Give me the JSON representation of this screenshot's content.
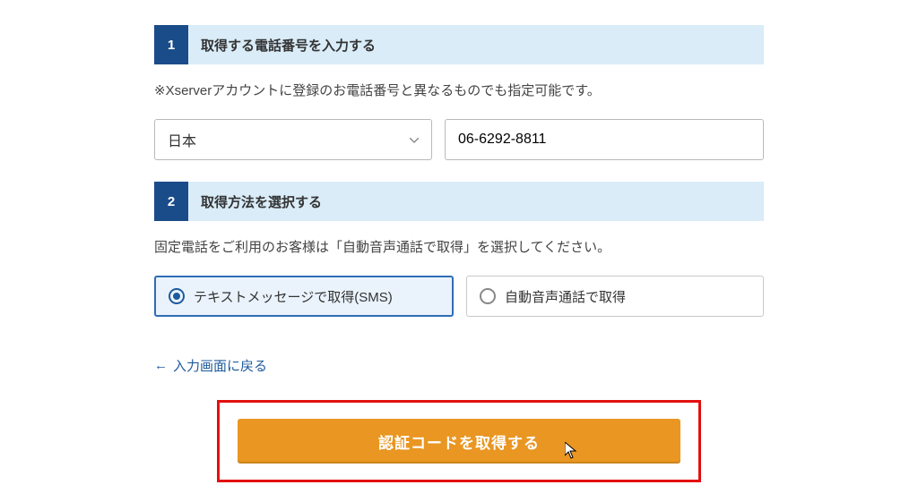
{
  "step1": {
    "num": "1",
    "title": "取得する電話番号を入力する",
    "note": "※Xserverアカウントに登録のお電話番号と異なるものでも指定可能です。",
    "country_label": "日本",
    "phone_value": "06-6292-8811"
  },
  "step2": {
    "num": "2",
    "title": "取得方法を選択する",
    "note": "固定電話をご利用のお客様は「自動音声通話で取得」を選択してください。",
    "option_sms": "テキストメッセージで取得(SMS)",
    "option_voice": "自動音声通話で取得"
  },
  "back_link": "入力画面に戻る",
  "submit_label": "認証コードを取得する"
}
